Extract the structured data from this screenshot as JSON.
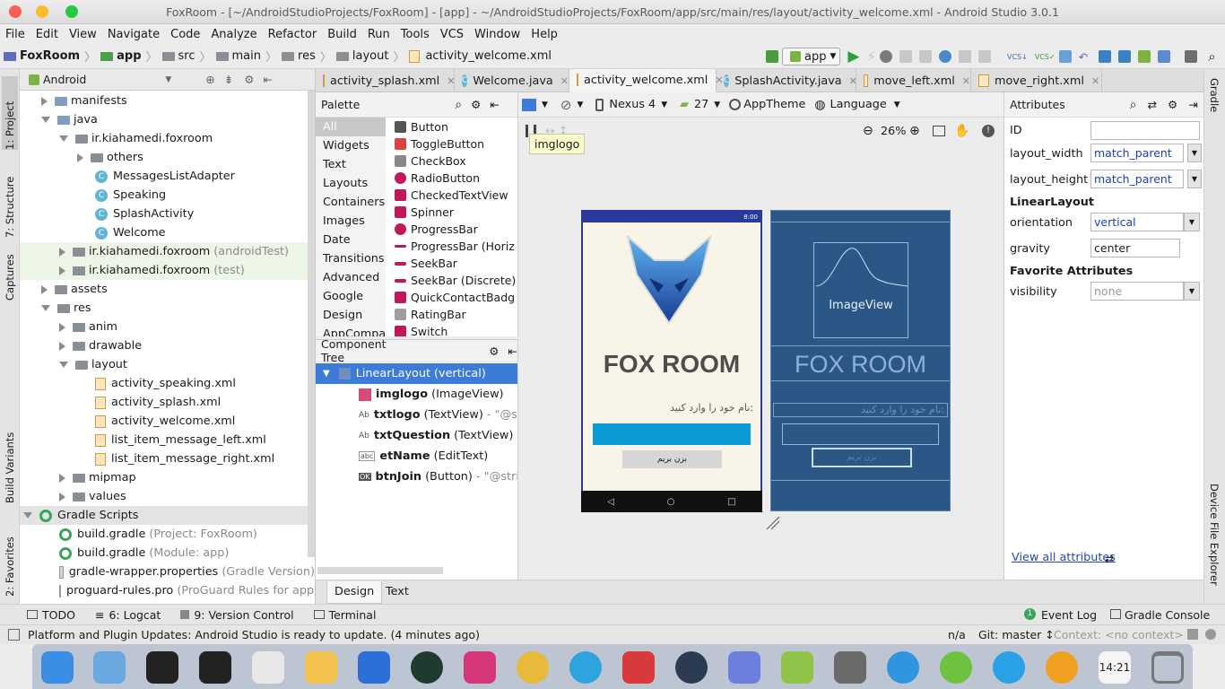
{
  "window": {
    "title": "FoxRoom - [~/AndroidStudioProjects/FoxRoom] - [app] - ~/AndroidStudioProjects/FoxRoom/app/src/main/res/layout/activity_welcome.xml - Android Studio 3.0.1"
  },
  "menu": [
    "File",
    "Edit",
    "View",
    "Navigate",
    "Code",
    "Analyze",
    "Refactor",
    "Build",
    "Run",
    "Tools",
    "VCS",
    "Window",
    "Help"
  ],
  "breadcrumb": [
    "FoxRoom",
    "app",
    "src",
    "main",
    "res",
    "layout",
    "activity_welcome.xml"
  ],
  "run_config": "app",
  "left_strip": {
    "project": "1: Project",
    "structure": "7: Structure",
    "captures": "Captures",
    "build_variants": "Build Variants",
    "favorites": "2: Favorites"
  },
  "right_strip": {
    "gradle": "Gradle",
    "device_explorer": "Device File Explorer"
  },
  "project_panel": {
    "view_mode": "Android",
    "tree": [
      {
        "label": "manifests",
        "suffix": ""
      },
      {
        "label": "java",
        "suffix": ""
      },
      {
        "label": "ir.kiahamedi.foxroom",
        "suffix": ""
      },
      {
        "label": "others",
        "suffix": ""
      },
      {
        "label": "MessagesListAdapter",
        "suffix": ""
      },
      {
        "label": "Speaking",
        "suffix": ""
      },
      {
        "label": "SplashActivity",
        "suffix": ""
      },
      {
        "label": "Welcome",
        "suffix": ""
      },
      {
        "label": "ir.kiahamedi.foxroom",
        "suffix": "(androidTest)"
      },
      {
        "label": "ir.kiahamedi.foxroom",
        "suffix": "(test)"
      },
      {
        "label": "assets",
        "suffix": ""
      },
      {
        "label": "res",
        "suffix": ""
      },
      {
        "label": "anim",
        "suffix": ""
      },
      {
        "label": "drawable",
        "suffix": ""
      },
      {
        "label": "layout",
        "suffix": ""
      },
      {
        "label": "activity_speaking.xml",
        "suffix": ""
      },
      {
        "label": "activity_splash.xml",
        "suffix": ""
      },
      {
        "label": "activity_welcome.xml",
        "suffix": ""
      },
      {
        "label": "list_item_message_left.xml",
        "suffix": ""
      },
      {
        "label": "list_item_message_right.xml",
        "suffix": ""
      },
      {
        "label": "mipmap",
        "suffix": ""
      },
      {
        "label": "values",
        "suffix": ""
      },
      {
        "label": "Gradle Scripts",
        "suffix": ""
      },
      {
        "label": "build.gradle",
        "suffix": "(Project: FoxRoom)"
      },
      {
        "label": "build.gradle",
        "suffix": "(Module: app)"
      },
      {
        "label": "gradle-wrapper.properties",
        "suffix": "(Gradle Version)"
      },
      {
        "label": "proguard-rules.pro",
        "suffix": "(ProGuard Rules for app)"
      }
    ]
  },
  "tabs": [
    "activity_splash.xml",
    "Welcome.java",
    "activity_welcome.xml",
    "SplashActivity.java",
    "move_left.xml",
    "move_right.xml"
  ],
  "palette": {
    "title": "Palette",
    "categories": [
      "All",
      "Widgets",
      "Text",
      "Layouts",
      "Containers",
      "Images",
      "Date",
      "Transitions",
      "Advanced",
      "Google",
      "Design",
      "AppCompat"
    ],
    "items": [
      "Button",
      "ToggleButton",
      "CheckBox",
      "RadioButton",
      "CheckedTextView",
      "Spinner",
      "ProgressBar",
      "ProgressBar (Horiz",
      "SeekBar",
      "SeekBar (Discrete)",
      "QuickContactBadg",
      "RatingBar",
      "Switch"
    ]
  },
  "design_toolbar": {
    "device": "Nexus 4",
    "api": "27",
    "theme": "AppTheme",
    "language": "Language",
    "zoom": "26%",
    "tooltip": "imglogo"
  },
  "component_tree": {
    "title": "Component Tree",
    "root": "LinearLayout (vertical)",
    "children": [
      {
        "id": "imglogo",
        "type": "(ImageView)",
        "extra": ""
      },
      {
        "id": "txtlogo",
        "type": "(TextView)",
        "extra": "- \"@string"
      },
      {
        "id": "txtQuestion",
        "type": "(TextView)",
        "extra": "- \"@"
      },
      {
        "id": "etName",
        "type": "(EditText)",
        "extra": ""
      },
      {
        "id": "btnJoin",
        "type": "(Button)",
        "extra": "- \"@string/b"
      }
    ]
  },
  "preview": {
    "time": "8:00",
    "app_name": "FOX ROOM",
    "question": "نام خود را وارد کنید:",
    "button": "بزن بریم",
    "blueprint_image": "ImageView"
  },
  "attributes": {
    "title": "Attributes",
    "id_label": "ID",
    "id_value": "",
    "layout_width_label": "layout_width",
    "layout_width": "match_parent",
    "layout_height_label": "layout_height",
    "layout_height": "match_parent",
    "section1": "LinearLayout",
    "orientation_label": "orientation",
    "orientation": "vertical",
    "gravity_label": "gravity",
    "gravity": "center",
    "section2": "Favorite Attributes",
    "visibility_label": "visibility",
    "visibility": "none",
    "view_all": "View all attributes"
  },
  "bottom_tabs": [
    "Design",
    "Text"
  ],
  "tool_windows": {
    "todo": "TODO",
    "logcat": "6: Logcat",
    "vc": "9: Version Control",
    "terminal": "Terminal",
    "eventlog": "Event Log",
    "eventlog_count": "1",
    "gradle_console": "Gradle Console"
  },
  "status": {
    "message": "Platform and Plugin Updates: Android Studio is ready to update. (4 minutes ago)",
    "position": "n/a",
    "git": "Git: master ↕",
    "context": "Context: <no context>"
  },
  "dock": {
    "clock": "14:21"
  },
  "colors": {
    "accent": "#4a88c7",
    "selection": "#3d7bd9",
    "phone_primary": "#2a3a9c",
    "phone_input": "#0a9ad6",
    "blueprint": "#2b5787"
  }
}
